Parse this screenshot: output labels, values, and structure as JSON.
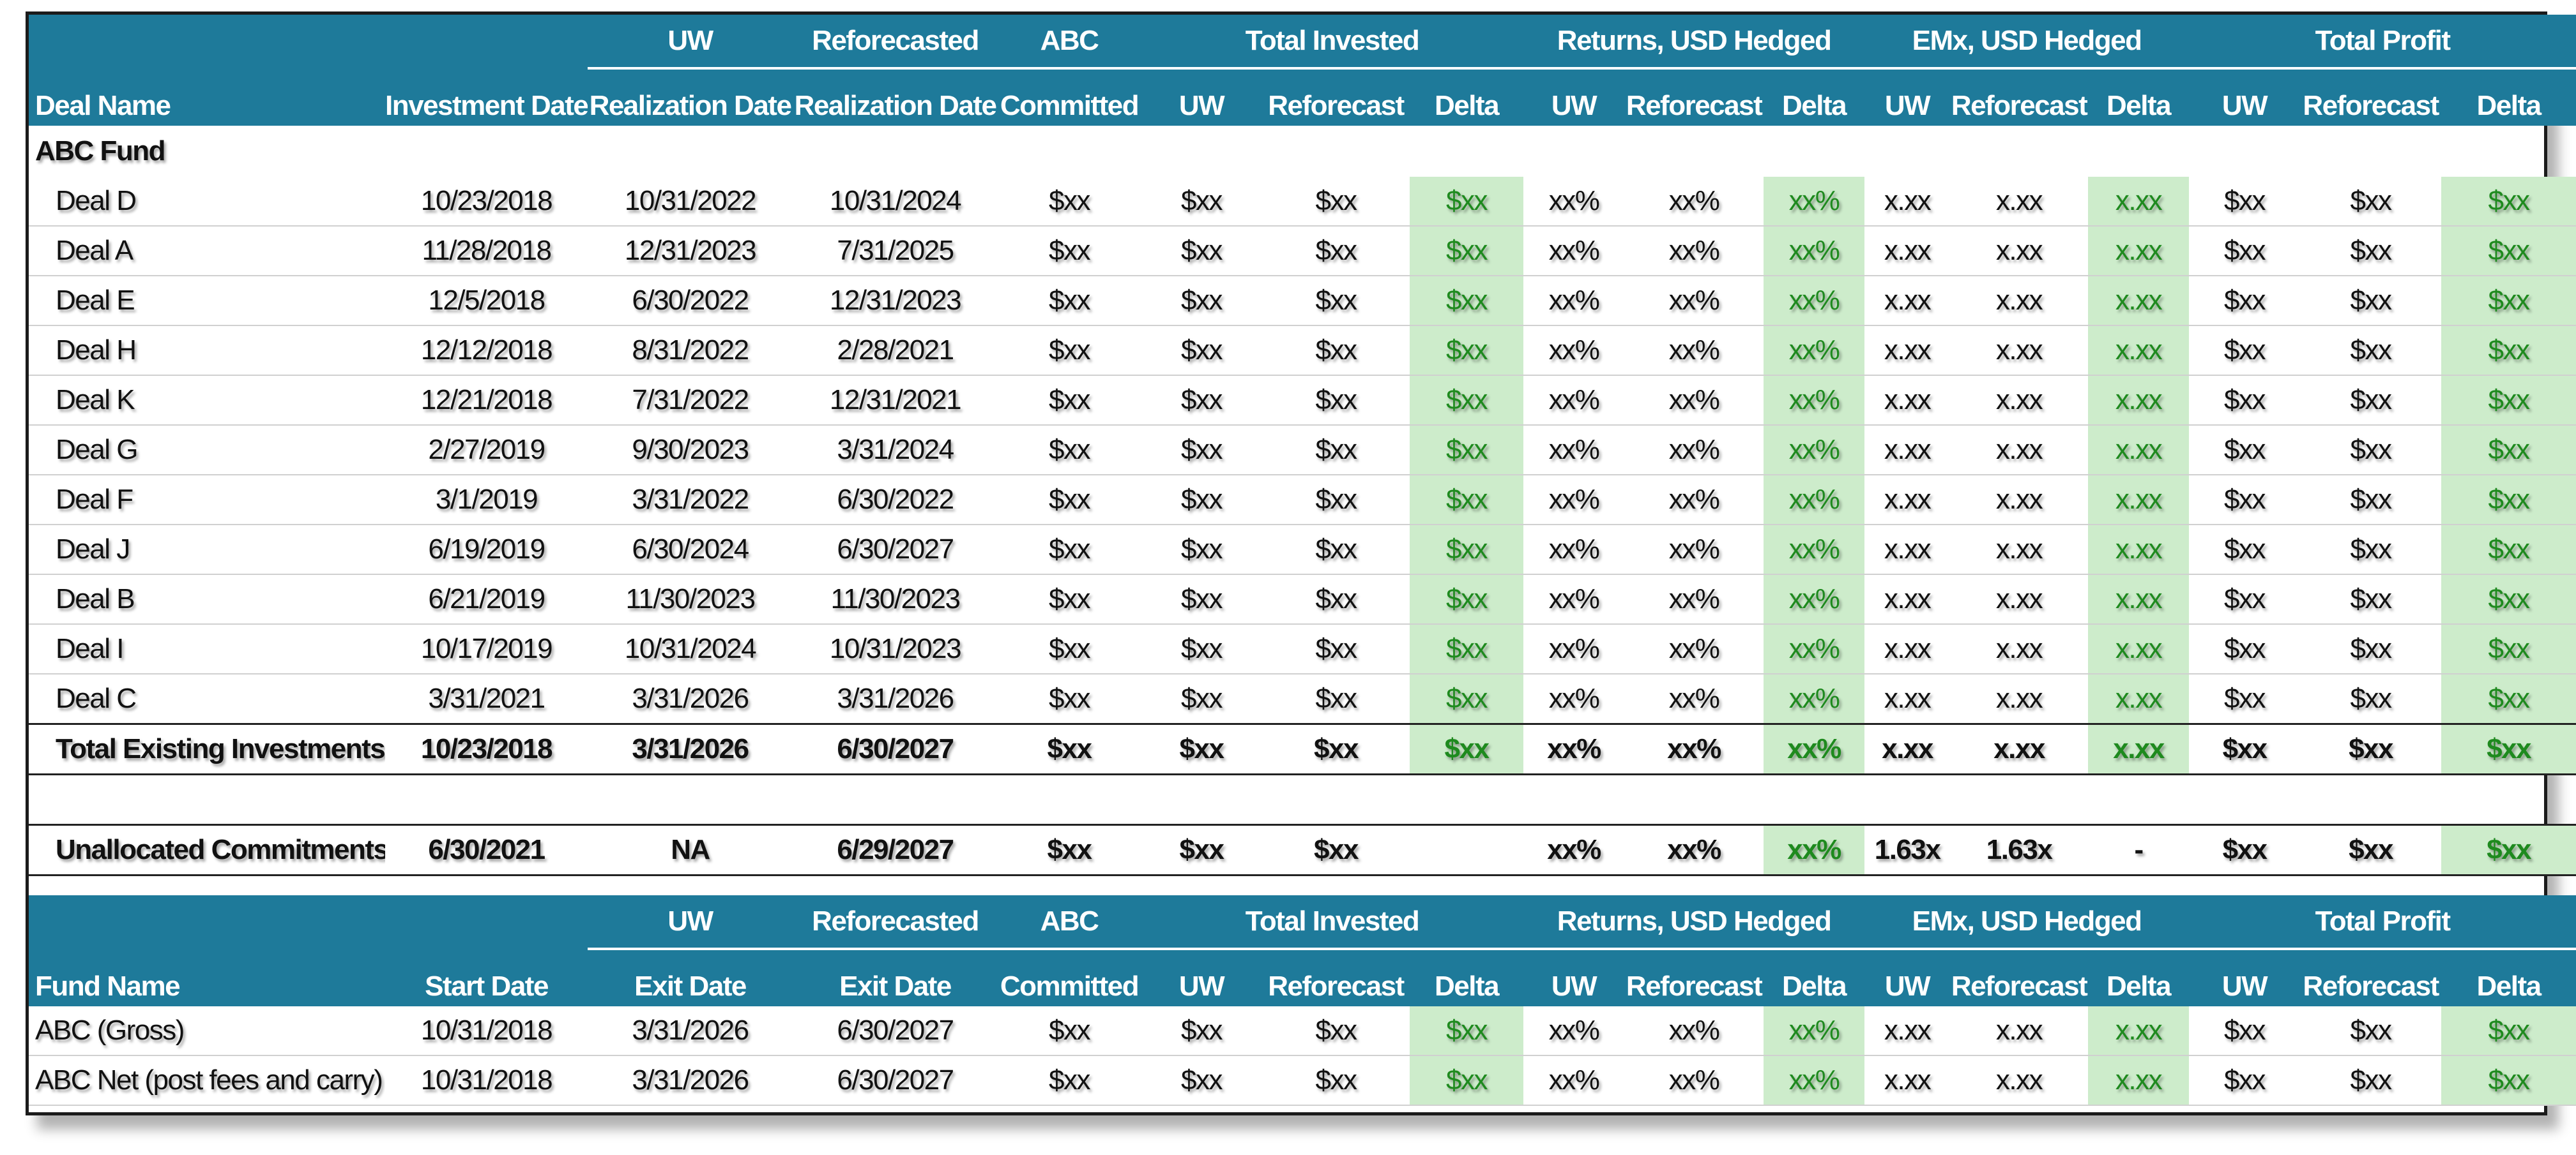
{
  "header": {
    "deal_name": "Deal Name",
    "investment_date": "Investment Date",
    "uw_top": "UW",
    "uw_realization_date": "Realization Date",
    "reforecasted_top": "Reforecasted",
    "reforecasted_realization_date": "Realization Date",
    "abc_top": "ABC",
    "committed": "Committed",
    "total_invested": "Total Invested",
    "returns": "Returns, USD Hedged",
    "emx": "EMx, USD Hedged",
    "total_profit": "Total Profit",
    "uw": "UW",
    "reforecast": "Reforecast",
    "delta": "Delta"
  },
  "fund_header": {
    "fund_name": "Fund Name",
    "start_date": "Start Date",
    "uw_top": "UW",
    "exit_date": "Exit Date",
    "reforecasted_top": "Reforecasted",
    "reforecasted_exit_date": "Exit Date",
    "abc_top": "ABC",
    "committed": "Committed"
  },
  "section_label": "ABC Fund",
  "deals": [
    {
      "name": "Deal D",
      "investment_date": "10/23/2018",
      "uw_realization": "10/31/2022",
      "ref_realization": "10/31/2024",
      "committed": "$xx",
      "ti_uw": "$xx",
      "ti_ref": "$xx",
      "ti_delta": "$xx",
      "ret_uw": "xx%",
      "ret_ref": "xx%",
      "ret_delta": "xx%",
      "emx_uw": "x.xx",
      "emx_ref": "x.xx",
      "emx_delta": "x.xx",
      "tp_uw": "$xx",
      "tp_ref": "$xx",
      "tp_delta": "$xx"
    },
    {
      "name": "Deal A",
      "investment_date": "11/28/2018",
      "uw_realization": "12/31/2023",
      "ref_realization": "7/31/2025",
      "committed": "$xx",
      "ti_uw": "$xx",
      "ti_ref": "$xx",
      "ti_delta": "$xx",
      "ret_uw": "xx%",
      "ret_ref": "xx%",
      "ret_delta": "xx%",
      "emx_uw": "x.xx",
      "emx_ref": "x.xx",
      "emx_delta": "x.xx",
      "tp_uw": "$xx",
      "tp_ref": "$xx",
      "tp_delta": "$xx"
    },
    {
      "name": "Deal E",
      "investment_date": "12/5/2018",
      "uw_realization": "6/30/2022",
      "ref_realization": "12/31/2023",
      "committed": "$xx",
      "ti_uw": "$xx",
      "ti_ref": "$xx",
      "ti_delta": "$xx",
      "ret_uw": "xx%",
      "ret_ref": "xx%",
      "ret_delta": "xx%",
      "emx_uw": "x.xx",
      "emx_ref": "x.xx",
      "emx_delta": "x.xx",
      "tp_uw": "$xx",
      "tp_ref": "$xx",
      "tp_delta": "$xx"
    },
    {
      "name": "Deal H",
      "investment_date": "12/12/2018",
      "uw_realization": "8/31/2022",
      "ref_realization": "2/28/2021",
      "committed": "$xx",
      "ti_uw": "$xx",
      "ti_ref": "$xx",
      "ti_delta": "$xx",
      "ret_uw": "xx%",
      "ret_ref": "xx%",
      "ret_delta": "xx%",
      "emx_uw": "x.xx",
      "emx_ref": "x.xx",
      "emx_delta": "x.xx",
      "tp_uw": "$xx",
      "tp_ref": "$xx",
      "tp_delta": "$xx"
    },
    {
      "name": "Deal K",
      "investment_date": "12/21/2018",
      "uw_realization": "7/31/2022",
      "ref_realization": "12/31/2021",
      "committed": "$xx",
      "ti_uw": "$xx",
      "ti_ref": "$xx",
      "ti_delta": "$xx",
      "ret_uw": "xx%",
      "ret_ref": "xx%",
      "ret_delta": "xx%",
      "emx_uw": "x.xx",
      "emx_ref": "x.xx",
      "emx_delta": "x.xx",
      "tp_uw": "$xx",
      "tp_ref": "$xx",
      "tp_delta": "$xx"
    },
    {
      "name": "Deal G",
      "investment_date": "2/27/2019",
      "uw_realization": "9/30/2023",
      "ref_realization": "3/31/2024",
      "committed": "$xx",
      "ti_uw": "$xx",
      "ti_ref": "$xx",
      "ti_delta": "$xx",
      "ret_uw": "xx%",
      "ret_ref": "xx%",
      "ret_delta": "xx%",
      "emx_uw": "x.xx",
      "emx_ref": "x.xx",
      "emx_delta": "x.xx",
      "tp_uw": "$xx",
      "tp_ref": "$xx",
      "tp_delta": "$xx"
    },
    {
      "name": "Deal F",
      "investment_date": "3/1/2019",
      "uw_realization": "3/31/2022",
      "ref_realization": "6/30/2022",
      "committed": "$xx",
      "ti_uw": "$xx",
      "ti_ref": "$xx",
      "ti_delta": "$xx",
      "ret_uw": "xx%",
      "ret_ref": "xx%",
      "ret_delta": "xx%",
      "emx_uw": "x.xx",
      "emx_ref": "x.xx",
      "emx_delta": "x.xx",
      "tp_uw": "$xx",
      "tp_ref": "$xx",
      "tp_delta": "$xx"
    },
    {
      "name": "Deal J",
      "investment_date": "6/19/2019",
      "uw_realization": "6/30/2024",
      "ref_realization": "6/30/2027",
      "committed": "$xx",
      "ti_uw": "$xx",
      "ti_ref": "$xx",
      "ti_delta": "$xx",
      "ret_uw": "xx%",
      "ret_ref": "xx%",
      "ret_delta": "xx%",
      "emx_uw": "x.xx",
      "emx_ref": "x.xx",
      "emx_delta": "x.xx",
      "tp_uw": "$xx",
      "tp_ref": "$xx",
      "tp_delta": "$xx"
    },
    {
      "name": "Deal B",
      "investment_date": "6/21/2019",
      "uw_realization": "11/30/2023",
      "ref_realization": "11/30/2023",
      "committed": "$xx",
      "ti_uw": "$xx",
      "ti_ref": "$xx",
      "ti_delta": "$xx",
      "ret_uw": "xx%",
      "ret_ref": "xx%",
      "ret_delta": "xx%",
      "emx_uw": "x.xx",
      "emx_ref": "x.xx",
      "emx_delta": "x.xx",
      "tp_uw": "$xx",
      "tp_ref": "$xx",
      "tp_delta": "$xx"
    },
    {
      "name": "Deal I",
      "investment_date": "10/17/2019",
      "uw_realization": "10/31/2024",
      "ref_realization": "10/31/2023",
      "committed": "$xx",
      "ti_uw": "$xx",
      "ti_ref": "$xx",
      "ti_delta": "$xx",
      "ret_uw": "xx%",
      "ret_ref": "xx%",
      "ret_delta": "xx%",
      "emx_uw": "x.xx",
      "emx_ref": "x.xx",
      "emx_delta": "x.xx",
      "tp_uw": "$xx",
      "tp_ref": "$xx",
      "tp_delta": "$xx"
    },
    {
      "name": "Deal C",
      "investment_date": "3/31/2021",
      "uw_realization": "3/31/2026",
      "ref_realization": "3/31/2026",
      "committed": "$xx",
      "ti_uw": "$xx",
      "ti_ref": "$xx",
      "ti_delta": "$xx",
      "ret_uw": "xx%",
      "ret_ref": "xx%",
      "ret_delta": "xx%",
      "emx_uw": "x.xx",
      "emx_ref": "x.xx",
      "emx_delta": "x.xx",
      "tp_uw": "$xx",
      "tp_ref": "$xx",
      "tp_delta": "$xx"
    }
  ],
  "total": {
    "name": "Total Existing Investments",
    "investment_date": "10/23/2018",
    "uw_realization": "3/31/2026",
    "ref_realization": "6/30/2027",
    "committed": "$xx",
    "ti_uw": "$xx",
    "ti_ref": "$xx",
    "ti_delta": "$xx",
    "ret_uw": "xx%",
    "ret_ref": "xx%",
    "ret_delta": "xx%",
    "emx_uw": "x.xx",
    "emx_ref": "x.xx",
    "emx_delta": "x.xx",
    "tp_uw": "$xx",
    "tp_ref": "$xx",
    "tp_delta": "$xx"
  },
  "unallocated": {
    "name": "Unallocated Commitments",
    "investment_date": "6/30/2021",
    "uw_realization": "NA",
    "ref_realization": "6/29/2027",
    "committed": "$xx",
    "ti_uw": "$xx",
    "ti_ref": "$xx",
    "ti_delta": "",
    "ret_uw": "xx%",
    "ret_ref": "xx%",
    "ret_delta": "xx%",
    "emx_uw": "1.63x",
    "emx_ref": "1.63x",
    "emx_delta": "-",
    "tp_uw": "$xx",
    "tp_ref": "$xx",
    "tp_delta": "$xx"
  },
  "funds": [
    {
      "name": "ABC (Gross)",
      "investment_date": "10/31/2018",
      "uw_realization": "3/31/2026",
      "ref_realization": "6/30/2027",
      "committed": "$xx",
      "ti_uw": "$xx",
      "ti_ref": "$xx",
      "ti_delta": "$xx",
      "ret_uw": "xx%",
      "ret_ref": "xx%",
      "ret_delta": "xx%",
      "emx_uw": "x.xx",
      "emx_ref": "x.xx",
      "emx_delta": "x.xx",
      "tp_uw": "$xx",
      "tp_ref": "$xx",
      "tp_delta": "$xx"
    },
    {
      "name": "ABC Net (post fees and carry)",
      "investment_date": "10/31/2018",
      "uw_realization": "3/31/2026",
      "ref_realization": "6/30/2027",
      "committed": "$xx",
      "ti_uw": "$xx",
      "ti_ref": "$xx",
      "ti_delta": "$xx",
      "ret_uw": "xx%",
      "ret_ref": "xx%",
      "ret_delta": "xx%",
      "emx_uw": "x.xx",
      "emx_ref": "x.xx",
      "emx_delta": "x.xx",
      "tp_uw": "$xx",
      "tp_ref": "$xx",
      "tp_delta": "$xx"
    }
  ],
  "colors": {
    "header_bg": "#1e7a9a",
    "delta_bg": "#cdeccb",
    "delta_text": "#1e8a1e"
  }
}
